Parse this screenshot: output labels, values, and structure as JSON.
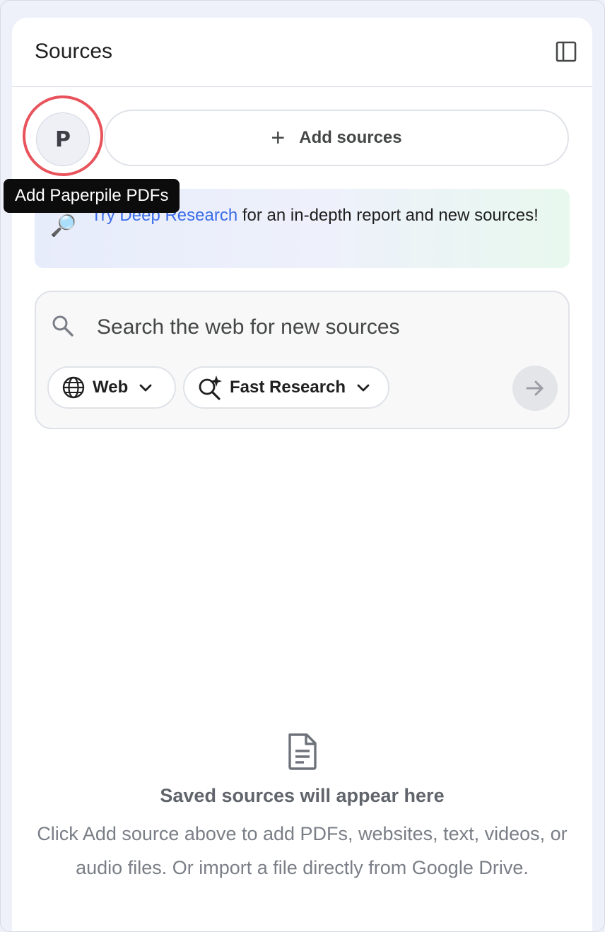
{
  "panel": {
    "title": "Sources",
    "collapse_icon": "panel-collapse-icon"
  },
  "paperpile": {
    "letter": "P",
    "tooltip": "Add Paperpile PDFs",
    "highlight_color": "#e8535c"
  },
  "add_sources": {
    "icon": "plus-icon",
    "label": "Add sources"
  },
  "deep_research_banner": {
    "icon": "magnifying-glass-emoji",
    "link_text": "Try Deep Research",
    "text": " for an in-depth report and new sources!",
    "link_color": "#3b6ce8"
  },
  "web_search": {
    "placeholder": "Search the web for new sources",
    "value": "",
    "source_chip": {
      "icon": "globe-icon",
      "label": "Web"
    },
    "mode_chip": {
      "icon": "sparkle-search-icon",
      "label": "Fast Research"
    },
    "submit_icon": "arrow-right-icon"
  },
  "empty_state": {
    "icon": "document-icon",
    "title": "Saved sources will appear here",
    "description": "Click Add source above to add PDFs, websites, text, videos, or audio files. Or import a file directly from Google Drive."
  }
}
